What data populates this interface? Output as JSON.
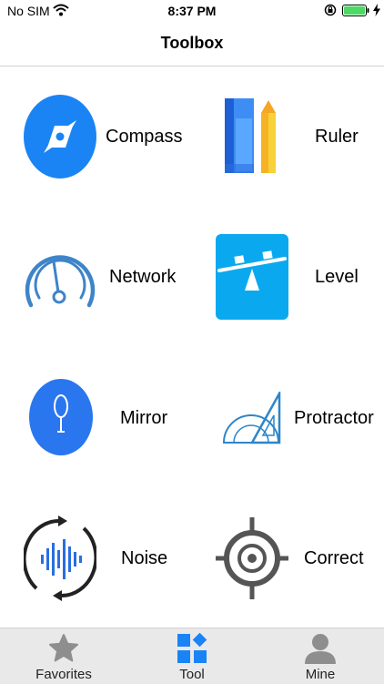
{
  "status_bar": {
    "carrier": "No SIM",
    "time": "8:37 PM"
  },
  "nav": {
    "title": "Toolbox"
  },
  "tools": [
    {
      "label": "Compass",
      "icon": "compass-icon"
    },
    {
      "label": "Ruler",
      "icon": "ruler-icon"
    },
    {
      "label": "Network",
      "icon": "network-gauge-icon"
    },
    {
      "label": "Level",
      "icon": "level-icon"
    },
    {
      "label": "Mirror",
      "icon": "mirror-icon"
    },
    {
      "label": "Protractor",
      "icon": "protractor-icon"
    },
    {
      "label": "Noise",
      "icon": "noise-icon"
    },
    {
      "label": "Correct",
      "icon": "crosshair-icon"
    }
  ],
  "tab_bar": {
    "items": [
      {
        "label": "Favorites",
        "icon": "star-icon",
        "selected": false
      },
      {
        "label": "Tool",
        "icon": "grid-icon",
        "selected": true
      },
      {
        "label": "Mine",
        "icon": "person-icon",
        "selected": false
      }
    ]
  },
  "colors": {
    "accent": "#1a84f5",
    "battery": "#4cd964",
    "inactive_tab_icon": "#8e8e8e"
  }
}
